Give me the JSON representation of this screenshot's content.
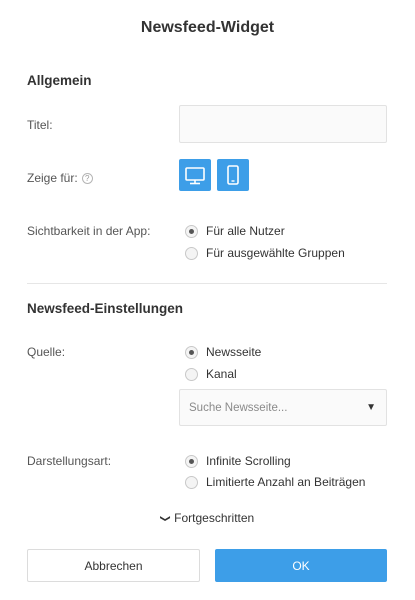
{
  "dialog": {
    "title": "Newsfeed-Widget"
  },
  "general": {
    "heading": "Allgemein",
    "title_label": "Titel:",
    "title_value": "",
    "show_for_label": "Zeige für:",
    "help_glyph": "?",
    "devices": [
      {
        "name": "desktop",
        "icon": "monitor-icon",
        "active": true
      },
      {
        "name": "mobile",
        "icon": "smartphone-icon",
        "active": true
      }
    ],
    "visibility_label": "Sichtbarkeit in der App:",
    "visibility_options": [
      {
        "label": "Für alle Nutzer",
        "selected": true
      },
      {
        "label": "Für ausgewählte Gruppen",
        "selected": false
      }
    ]
  },
  "newsfeed": {
    "heading": "Newsfeed-Einstellungen",
    "source_label": "Quelle:",
    "source_options": [
      {
        "label": "Newsseite",
        "selected": true
      },
      {
        "label": "Kanal",
        "selected": false
      }
    ],
    "search_placeholder": "Suche Newsseite...",
    "display_label": "Darstellungsart:",
    "display_options": [
      {
        "label": "Infinite Scrolling",
        "selected": true
      },
      {
        "label": "Limitierte Anzahl an Beiträgen",
        "selected": false
      }
    ],
    "advanced_label": "Fortgeschritten",
    "advanced_glyph": "❯"
  },
  "footer": {
    "cancel_label": "Abbrechen",
    "ok_label": "OK"
  },
  "colors": {
    "accent": "#3d9ee8"
  }
}
